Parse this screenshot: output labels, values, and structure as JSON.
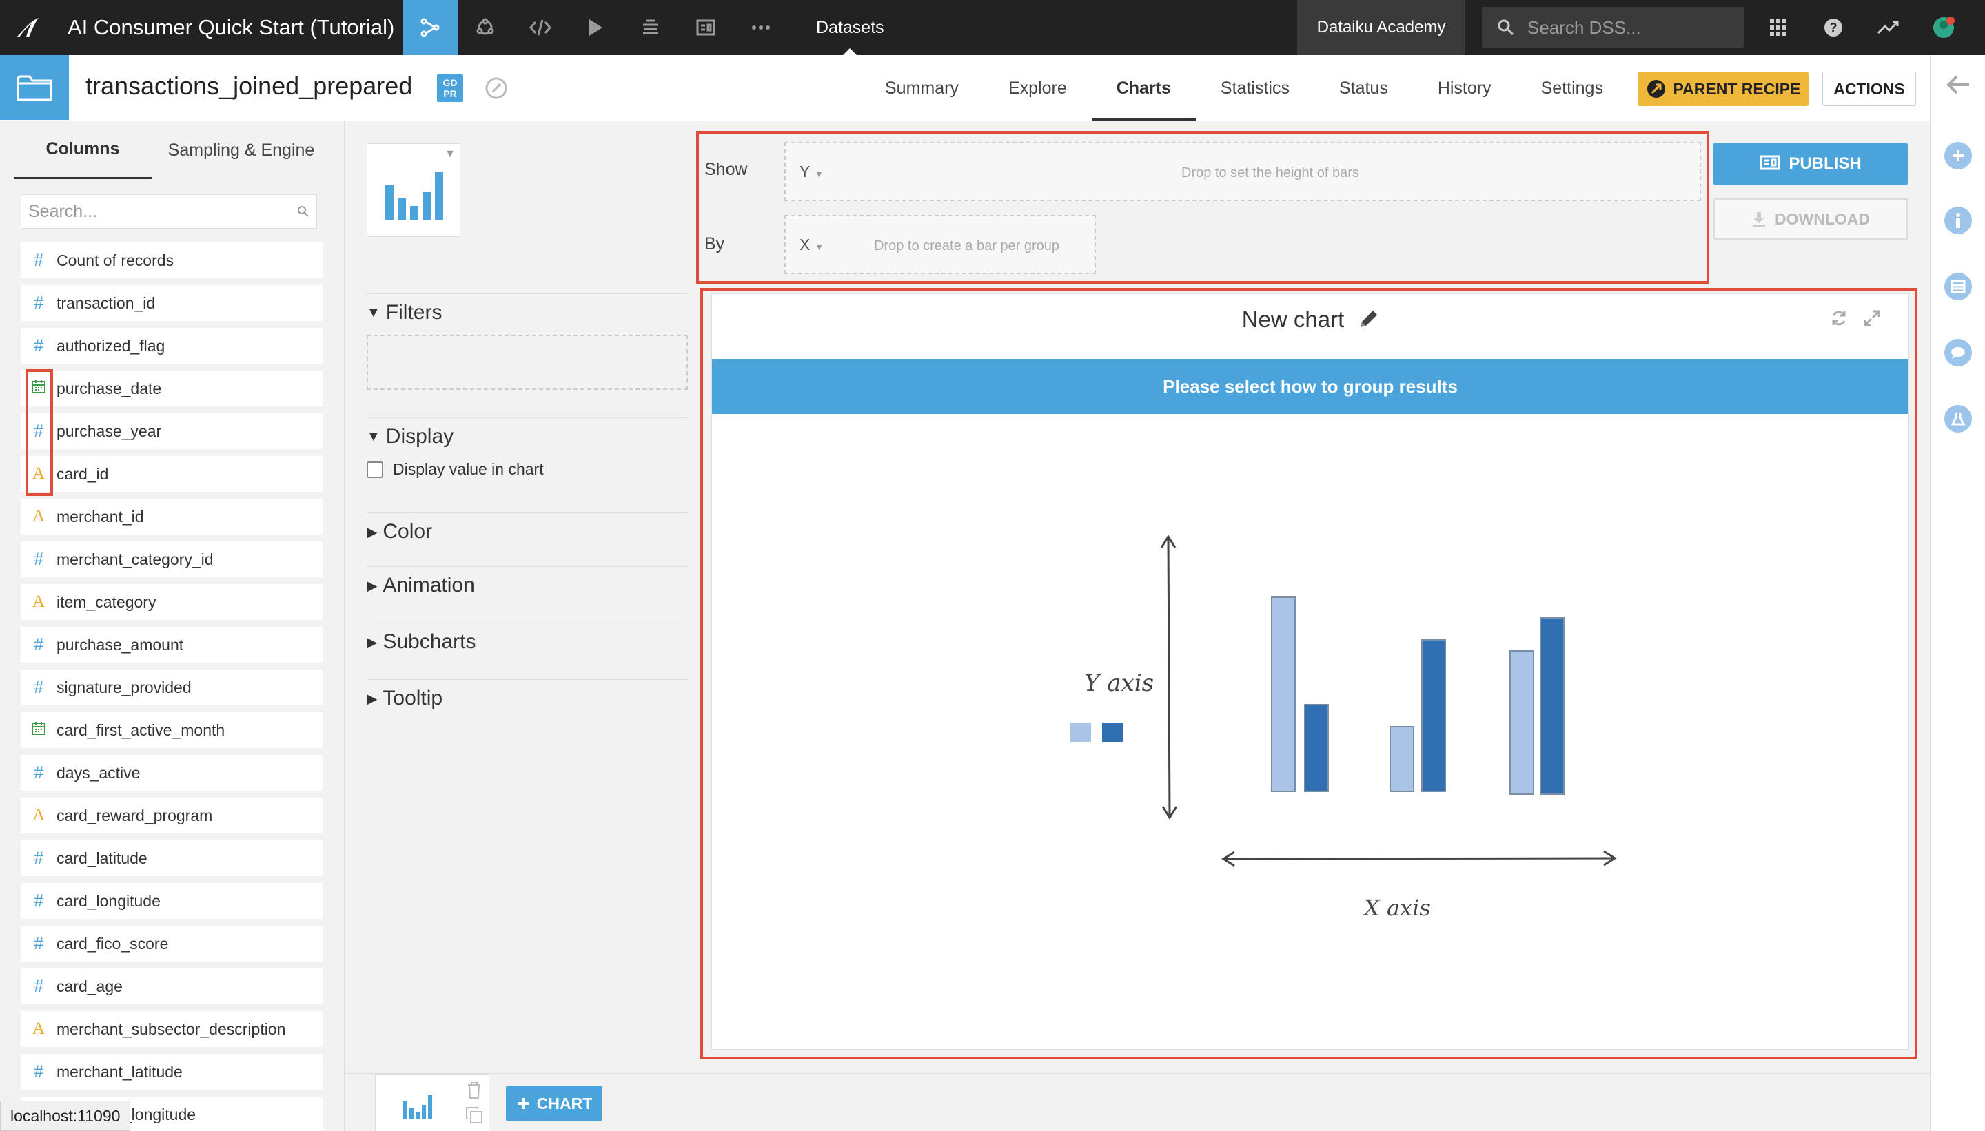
{
  "topbar": {
    "project_title": "AI Consumer Quick Start (Tutorial)",
    "current_section": "Datasets",
    "academy_label": "Dataiku Academy",
    "search_placeholder": "Search DSS..."
  },
  "dataset": {
    "name": "transactions_joined_prepared",
    "badge": "GDPR",
    "tabs": [
      "Summary",
      "Explore",
      "Charts",
      "Statistics",
      "Status",
      "History",
      "Settings"
    ],
    "active_tab": "Charts",
    "parent_recipe_label": "PARENT RECIPE",
    "actions_label": "ACTIONS"
  },
  "left_panel": {
    "tabs": [
      "Columns",
      "Sampling & Engine"
    ],
    "search_placeholder": "Search...",
    "columns": [
      {
        "type": "num",
        "name": "Count of records"
      },
      {
        "type": "num",
        "name": "transaction_id"
      },
      {
        "type": "num",
        "name": "authorized_flag"
      },
      {
        "type": "date",
        "name": "purchase_date"
      },
      {
        "type": "num",
        "name": "purchase_year"
      },
      {
        "type": "str",
        "name": "card_id"
      },
      {
        "type": "str",
        "name": "merchant_id"
      },
      {
        "type": "num",
        "name": "merchant_category_id"
      },
      {
        "type": "str",
        "name": "item_category"
      },
      {
        "type": "num",
        "name": "purchase_amount"
      },
      {
        "type": "num",
        "name": "signature_provided"
      },
      {
        "type": "date",
        "name": "card_first_active_month"
      },
      {
        "type": "num",
        "name": "days_active"
      },
      {
        "type": "str",
        "name": "card_reward_program"
      },
      {
        "type": "num",
        "name": "card_latitude"
      },
      {
        "type": "num",
        "name": "card_longitude"
      },
      {
        "type": "num",
        "name": "card_fico_score"
      },
      {
        "type": "num",
        "name": "card_age"
      },
      {
        "type": "str",
        "name": "merchant_subsector_description"
      },
      {
        "type": "num",
        "name": "merchant_latitude"
      },
      {
        "type": "num",
        "name": "merchant_longitude"
      }
    ]
  },
  "status_bar": {
    "url": "localhost:11090"
  },
  "middle_panel": {
    "sections": [
      "Filters",
      "Display",
      "Color",
      "Animation",
      "Subcharts",
      "Tooltip"
    ],
    "display_checkbox_label": "Display value in chart"
  },
  "bottom": {
    "add_chart_label": "CHART"
  },
  "config": {
    "show_label": "Show",
    "by_label": "By",
    "y_axis": "Y",
    "x_axis": "X",
    "y_hint": "Drop to set the height of bars",
    "x_hint": "Drop to create a bar per group",
    "publish_label": "PUBLISH",
    "download_label": "DOWNLOAD"
  },
  "chart": {
    "title": "New chart",
    "banner": "Please select how to group results",
    "sketch_y_label": "Y axis",
    "sketch_x_label": "X axis",
    "light_bar_color": "#a9c4e6",
    "dark_bar_color": "#2f6fb2"
  },
  "colors": {
    "accent_blue": "#4ba3db",
    "highlight_red": "#e04b3a",
    "parent_recipe_yellow": "#f0b83a",
    "topbar_dark": "#222222"
  }
}
